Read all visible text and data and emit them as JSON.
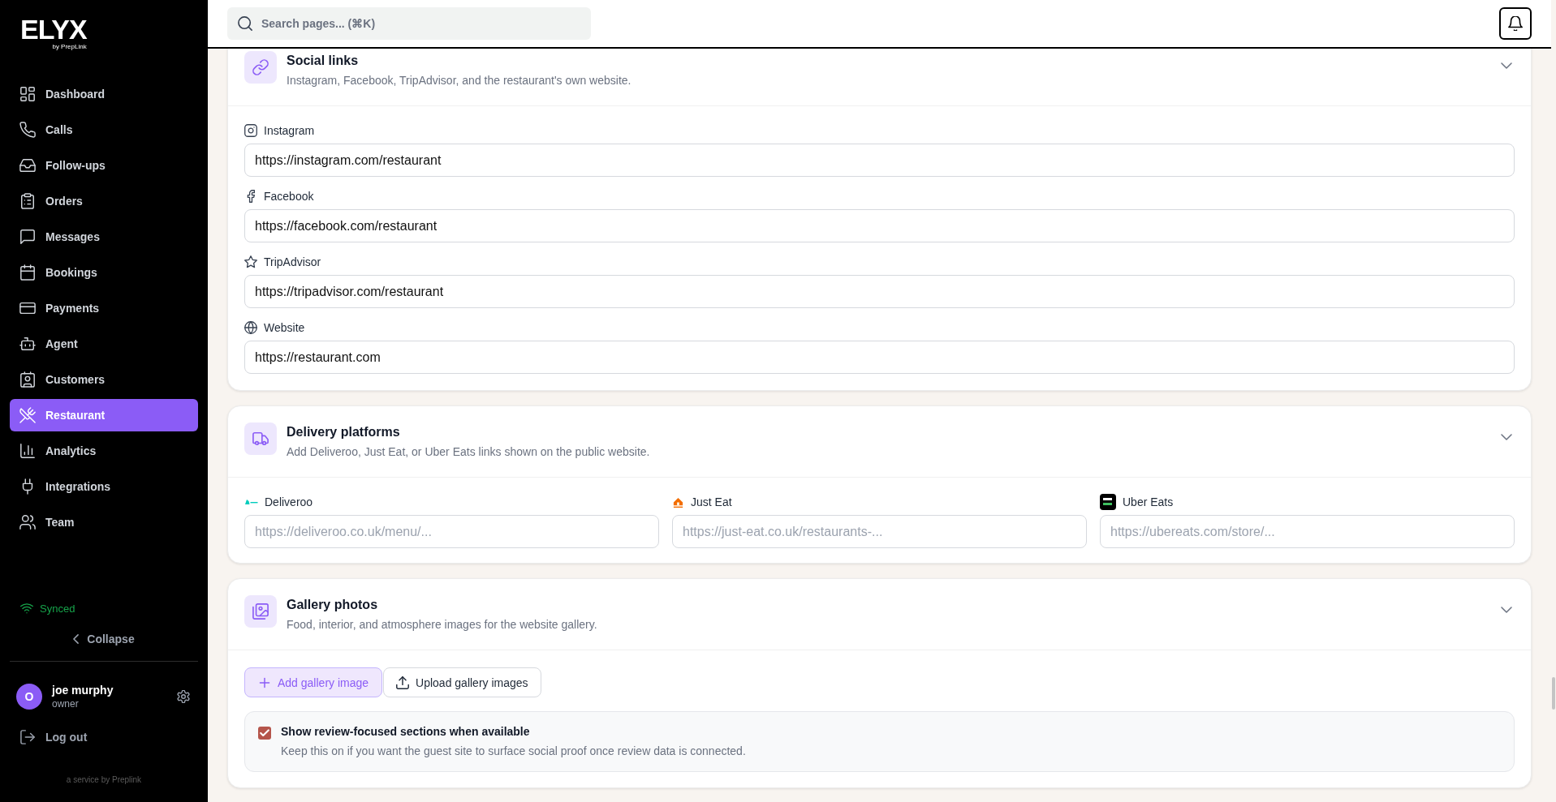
{
  "sidebar": {
    "logo": {
      "wordmark": "ELYX",
      "tagline": "by PrepLink"
    },
    "nav": [
      {
        "label": "Dashboard",
        "selected": false
      },
      {
        "label": "Calls",
        "selected": false
      },
      {
        "label": "Follow-ups",
        "selected": false
      },
      {
        "label": "Orders",
        "selected": false
      },
      {
        "label": "Messages",
        "selected": false
      },
      {
        "label": "Bookings",
        "selected": false
      },
      {
        "label": "Payments",
        "selected": false
      },
      {
        "label": "Agent",
        "selected": false
      },
      {
        "label": "Customers",
        "selected": false
      },
      {
        "label": "Restaurant",
        "selected": true
      },
      {
        "label": "Analytics",
        "selected": false
      },
      {
        "label": "Integrations",
        "selected": false
      },
      {
        "label": "Team",
        "selected": false
      }
    ],
    "sync_status": "Synced",
    "collapse": "Collapse",
    "user": {
      "initial": "O",
      "name": "joe murphy",
      "role": "owner"
    },
    "logout": "Log out",
    "footer": "a service by Preplink"
  },
  "header": {
    "search": {
      "placeholder": "Search pages... (⌘K)"
    }
  },
  "sections": [
    {
      "kind": "links",
      "title": "Social links",
      "subtitle": "Instagram, Facebook, TripAdvisor, and the restaurant's own website.",
      "fields": [
        {
          "label": "Instagram",
          "value": "https://instagram.com/restaurant"
        },
        {
          "label": "Facebook",
          "value": "https://facebook.com/restaurant"
        },
        {
          "label": "TripAdvisor",
          "value": "https://tripadvisor.com/restaurant"
        },
        {
          "label": "Website",
          "value": "https://restaurant.com"
        }
      ]
    },
    {
      "kind": "platforms",
      "title": "Delivery platforms",
      "subtitle": "Add Deliveroo, Just Eat, or Uber Eats links shown on the public website.",
      "fields": [
        {
          "label": "Deliveroo",
          "placeholder": "https://deliveroo.co.uk/menu/..."
        },
        {
          "label": "Just Eat",
          "placeholder": "https://just-eat.co.uk/restaurants-..."
        },
        {
          "label": "Uber Eats",
          "placeholder": "https://ubereats.com/store/..."
        }
      ]
    },
    {
      "kind": "gallery",
      "title": "Gallery photos",
      "subtitle": "Food, interior, and atmosphere images for the website gallery.",
      "buttons": [
        {
          "kind": "primary",
          "label": "Add gallery image"
        },
        {
          "kind": "secondary",
          "label": "Upload gallery images"
        }
      ],
      "option": {
        "label": "Show review-focused sections when available",
        "help": "Keep this on if you want the guest site to surface social proof once review data is connected.",
        "checked": true
      }
    }
  ]
}
